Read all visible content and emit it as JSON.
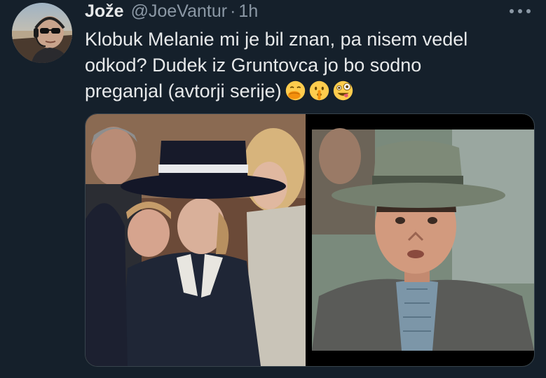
{
  "author": {
    "name": "Jože",
    "handle": "@JoeVantur",
    "separator": "·",
    "time": "1h"
  },
  "tweet": {
    "lines": [
      "Klobuk Melanie mi je bil znan, pa nisem vedel",
      "odkod? Dudek iz Gruntovca jo bo sodno",
      "preganjal (avtorji serije)"
    ],
    "emoji_names": [
      "face-with-hand-over-mouth",
      "shushing-face",
      "zany-face"
    ]
  },
  "media": {
    "left_image": "woman-wide-brim-hat-photo",
    "right_image": "man-fedora-hat-photo"
  },
  "colors": {
    "background": "#15202b",
    "text": "#e7e9ea",
    "secondary": "#8b98a5",
    "border": "#38444d"
  }
}
